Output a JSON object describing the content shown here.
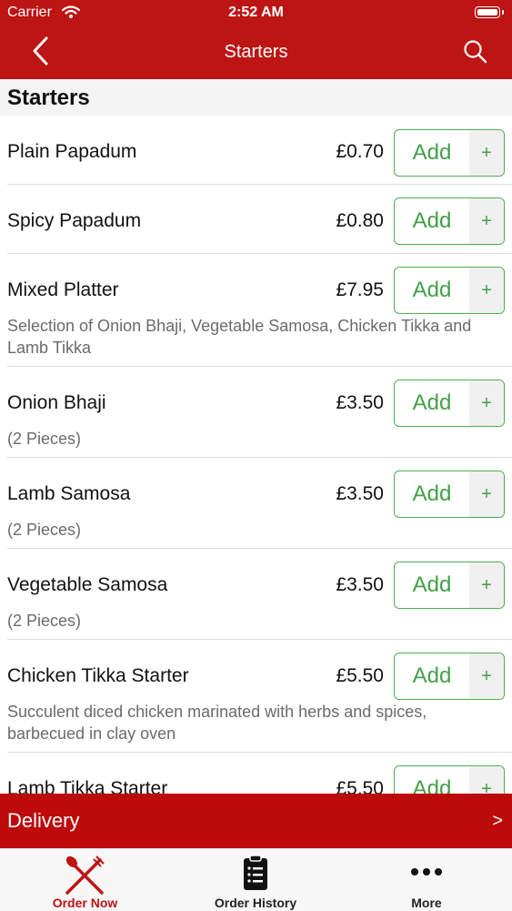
{
  "status_bar": {
    "carrier": "Carrier",
    "time": "2:52 AM"
  },
  "header": {
    "title": "Starters",
    "back_icon": "chevron-left-icon",
    "search_icon": "search-icon"
  },
  "section": {
    "title": "Starters"
  },
  "items": [
    {
      "name": "Plain Papadum",
      "price": "£0.70",
      "description": "",
      "add_label": "Add",
      "plus": "+"
    },
    {
      "name": "Spicy Papadum",
      "price": "£0.80",
      "description": "",
      "add_label": "Add",
      "plus": "+"
    },
    {
      "name": "Mixed Platter",
      "price": "£7.95",
      "description": "Selection of Onion Bhaji, Vegetable Samosa, Chicken Tikka and Lamb Tikka",
      "add_label": "Add",
      "plus": "+"
    },
    {
      "name": "Onion Bhaji",
      "price": "£3.50",
      "description": "(2 Pieces)",
      "add_label": "Add",
      "plus": "+"
    },
    {
      "name": "Lamb Samosa",
      "price": "£3.50",
      "description": "(2 Pieces)",
      "add_label": "Add",
      "plus": "+"
    },
    {
      "name": "Vegetable Samosa",
      "price": "£3.50",
      "description": "(2 Pieces)",
      "add_label": "Add",
      "plus": "+"
    },
    {
      "name": "Chicken Tikka Starter",
      "price": "£5.50",
      "description": "Succulent diced chicken marinated with herbs and spices, barbecued in clay oven",
      "add_label": "Add",
      "plus": "+"
    },
    {
      "name": "Lamb Tikka Starter",
      "price": "£5.50",
      "description": "",
      "add_label": "Add",
      "plus": "+"
    }
  ],
  "delivery": {
    "label": "Delivery",
    "chevron": ">"
  },
  "tabbar": {
    "tabs": [
      {
        "label": "Order Now",
        "icon": "fork-knife-icon",
        "active": true
      },
      {
        "label": "Order History",
        "icon": "clipboard-list-icon",
        "active": false
      },
      {
        "label": "More",
        "icon": "more-dots-icon",
        "active": false
      }
    ]
  },
  "colors": {
    "brand_red": "#bd1414",
    "add_green": "#43a047"
  }
}
